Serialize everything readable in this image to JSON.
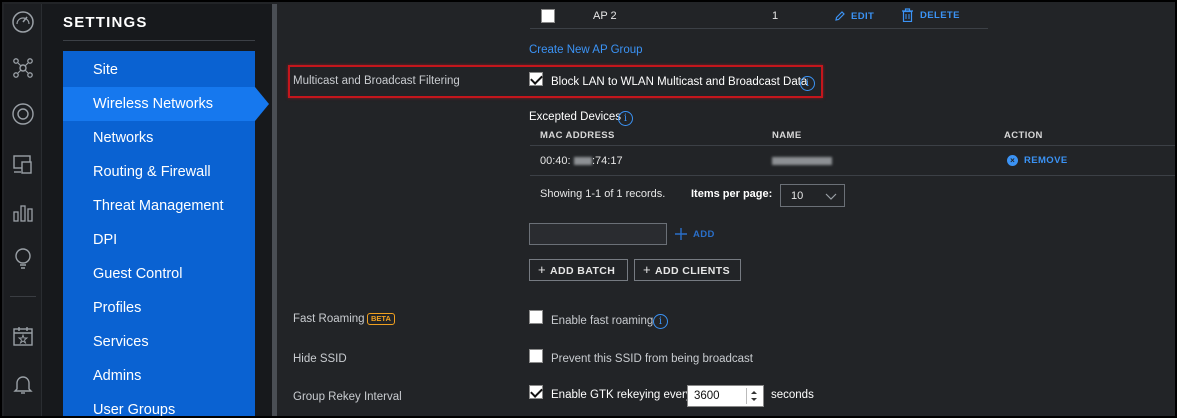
{
  "settings": {
    "title": "SETTINGS",
    "items": [
      {
        "label": "Site"
      },
      {
        "label": "Wireless Networks",
        "active": true
      },
      {
        "label": "Networks"
      },
      {
        "label": "Routing & Firewall"
      },
      {
        "label": "Threat Management"
      },
      {
        "label": "DPI"
      },
      {
        "label": "Guest Control"
      },
      {
        "label": "Profiles"
      },
      {
        "label": "Services"
      },
      {
        "label": "Admins"
      },
      {
        "label": "User Groups"
      }
    ]
  },
  "ap_group_row": {
    "name": "AP 2",
    "count": "1",
    "edit_label": "EDIT",
    "delete_label": "DELETE"
  },
  "create_ap_group_link": "Create New AP Group",
  "multicast": {
    "label": "Multicast and Broadcast Filtering",
    "checkbox_label": "Block LAN to WLAN Multicast and Broadcast Data",
    "checked": true
  },
  "excepted_devices": {
    "title": "Excepted Devices",
    "columns": {
      "mac": "MAC ADDRESS",
      "name": "NAME",
      "action": "ACTION"
    },
    "rows": [
      {
        "mac_prefix": "00:40:",
        "mac_suffix": ":74:17",
        "remove_label": "REMOVE"
      }
    ],
    "showing_text": "Showing 1-1 of 1 records.",
    "items_per_page_label": "Items per page:",
    "items_per_page_value": "10",
    "add_label": "ADD",
    "add_batch_label": "ADD BATCH",
    "add_clients_label": "ADD CLIENTS"
  },
  "fast_roaming": {
    "label": "Fast Roaming",
    "badge": "BETA",
    "checkbox_label": "Enable fast roaming",
    "checked": false
  },
  "hide_ssid": {
    "label": "Hide SSID",
    "checkbox_label": "Prevent this SSID from being broadcast",
    "checked": false
  },
  "group_rekey": {
    "label": "Group Rekey Interval",
    "checkbox_label": "Enable GTK rekeying every",
    "checked": true,
    "value": "3600",
    "unit": "seconds"
  },
  "colors": {
    "accent": "#0a62d2",
    "active": "#1678ee",
    "link": "#3b93f5",
    "highlight": "#c4161c"
  }
}
